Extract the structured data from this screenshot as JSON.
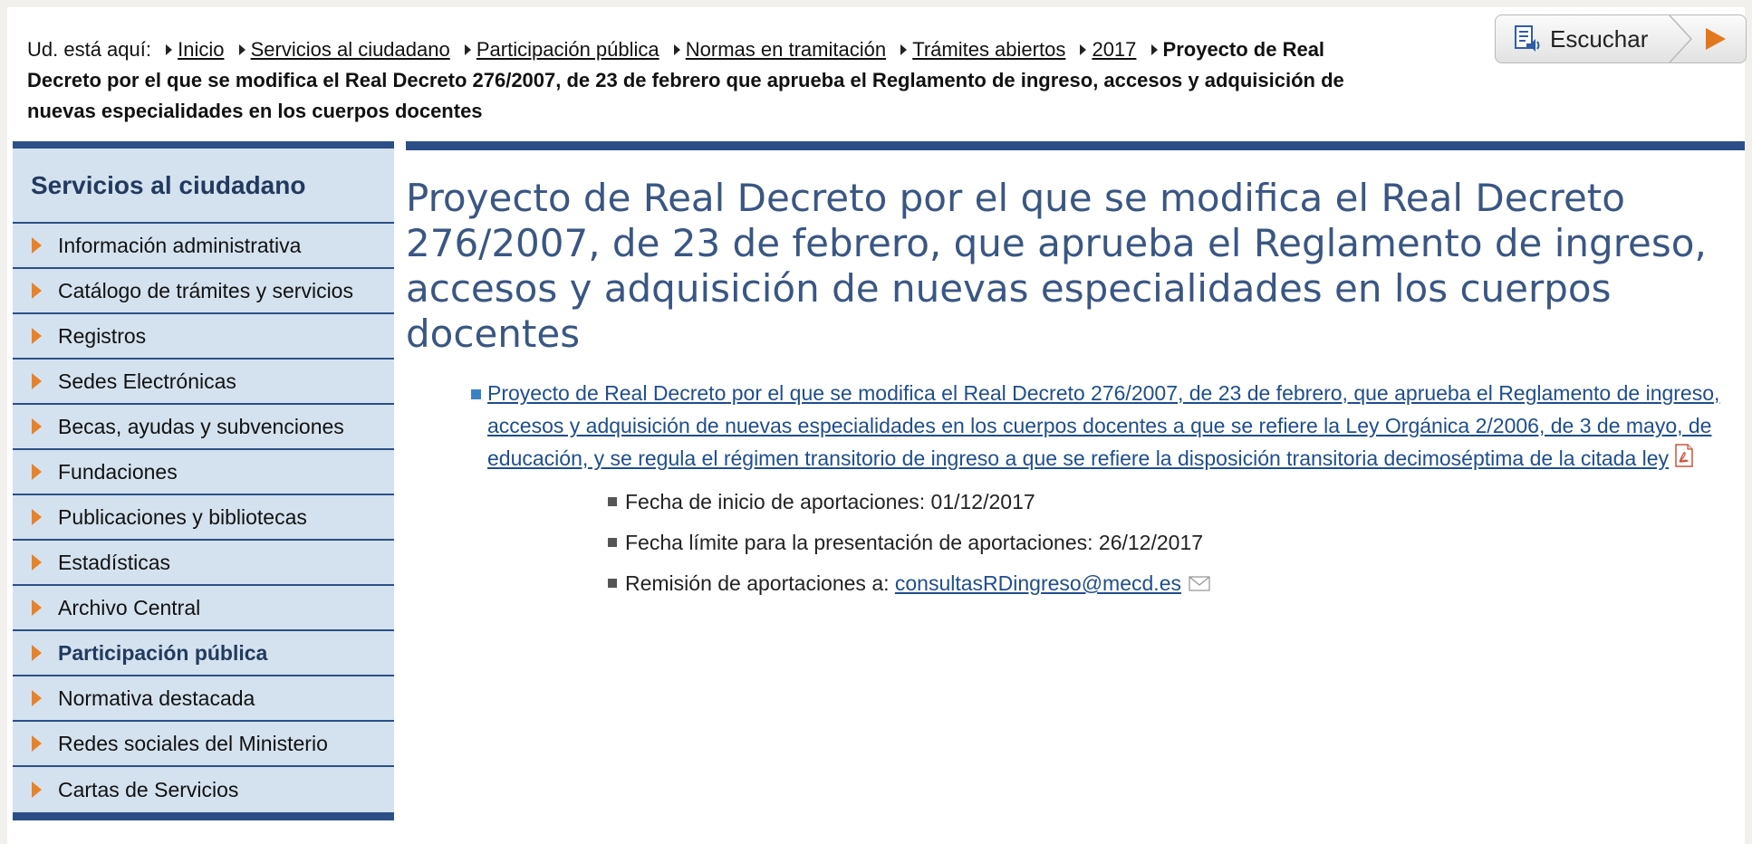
{
  "breadcrumb": {
    "prefix": "Ud. está aquí:",
    "links": [
      "Inicio",
      "Servicios al ciudadano",
      "Participación pública",
      "Normas en tramitación",
      "Trámites abiertos",
      "2017"
    ],
    "current": "Proyecto de Real Decreto por el que se modifica el Real Decreto 276/2007, de 23 de febrero que aprueba el Reglamento de ingreso, accesos y adquisición de nuevas especialidades en los cuerpos docentes"
  },
  "listen_button": {
    "label": "Escuchar",
    "icon": "document-speaker-icon",
    "play_icon": "play-icon",
    "play_color": "#e2781d"
  },
  "sidebar": {
    "title": "Servicios al ciudadano",
    "items": [
      {
        "label": "Información administrativa",
        "active": false
      },
      {
        "label": "Catálogo de trámites y servicios",
        "active": false
      },
      {
        "label": "Registros",
        "active": false
      },
      {
        "label": "Sedes Electrónicas",
        "active": false
      },
      {
        "label": "Becas, ayudas y subvenciones",
        "active": false
      },
      {
        "label": "Fundaciones",
        "active": false
      },
      {
        "label": "Publicaciones y bibliotecas",
        "active": false
      },
      {
        "label": "Estadísticas",
        "active": false
      },
      {
        "label": "Archivo Central",
        "active": false
      },
      {
        "label": "Participación pública",
        "active": true
      },
      {
        "label": "Normativa destacada",
        "active": false
      },
      {
        "label": "Redes sociales del Ministerio",
        "active": false
      },
      {
        "label": "Cartas de Servicios",
        "active": false
      }
    ]
  },
  "main": {
    "title": "Proyecto de Real Decreto por el que se modifica el Real Decreto 276/2007, de 23 de febrero, que aprueba el Reglamento de ingreso, accesos y adquisición de nuevas especialidades en los cuerpos docentes",
    "document": {
      "link_text": "Proyecto de Real Decreto por el que se modifica el Real Decreto 276/2007, de 23 de febrero, que aprueba el Reglamento de ingreso, accesos y adquisición de nuevas especialidades en los cuerpos docentes a que se refiere la Ley Orgánica 2/2006, de 3 de mayo, de educación, y se regula el régimen transitorio de ingreso a que se refiere la disposición transitoria decimoséptima de la citada ley",
      "file_icon": "pdf-icon",
      "start_date": "Fecha de inicio de aportaciones: 01/12/2017",
      "deadline": "Fecha límite para la presentación de aportaciones: 26/12/2017",
      "submission_label": "Remisión de aportaciones a:",
      "submission_email": "consultasRDingreso@mecd.es",
      "email_icon": "envelope-icon"
    }
  },
  "colors": {
    "accent_blue": "#2c4f87",
    "sidebar_bg": "#d4e2ef",
    "title_blue": "#3a5683",
    "link_blue": "#1f4e8c",
    "bullet_orange": "#e8822a"
  }
}
